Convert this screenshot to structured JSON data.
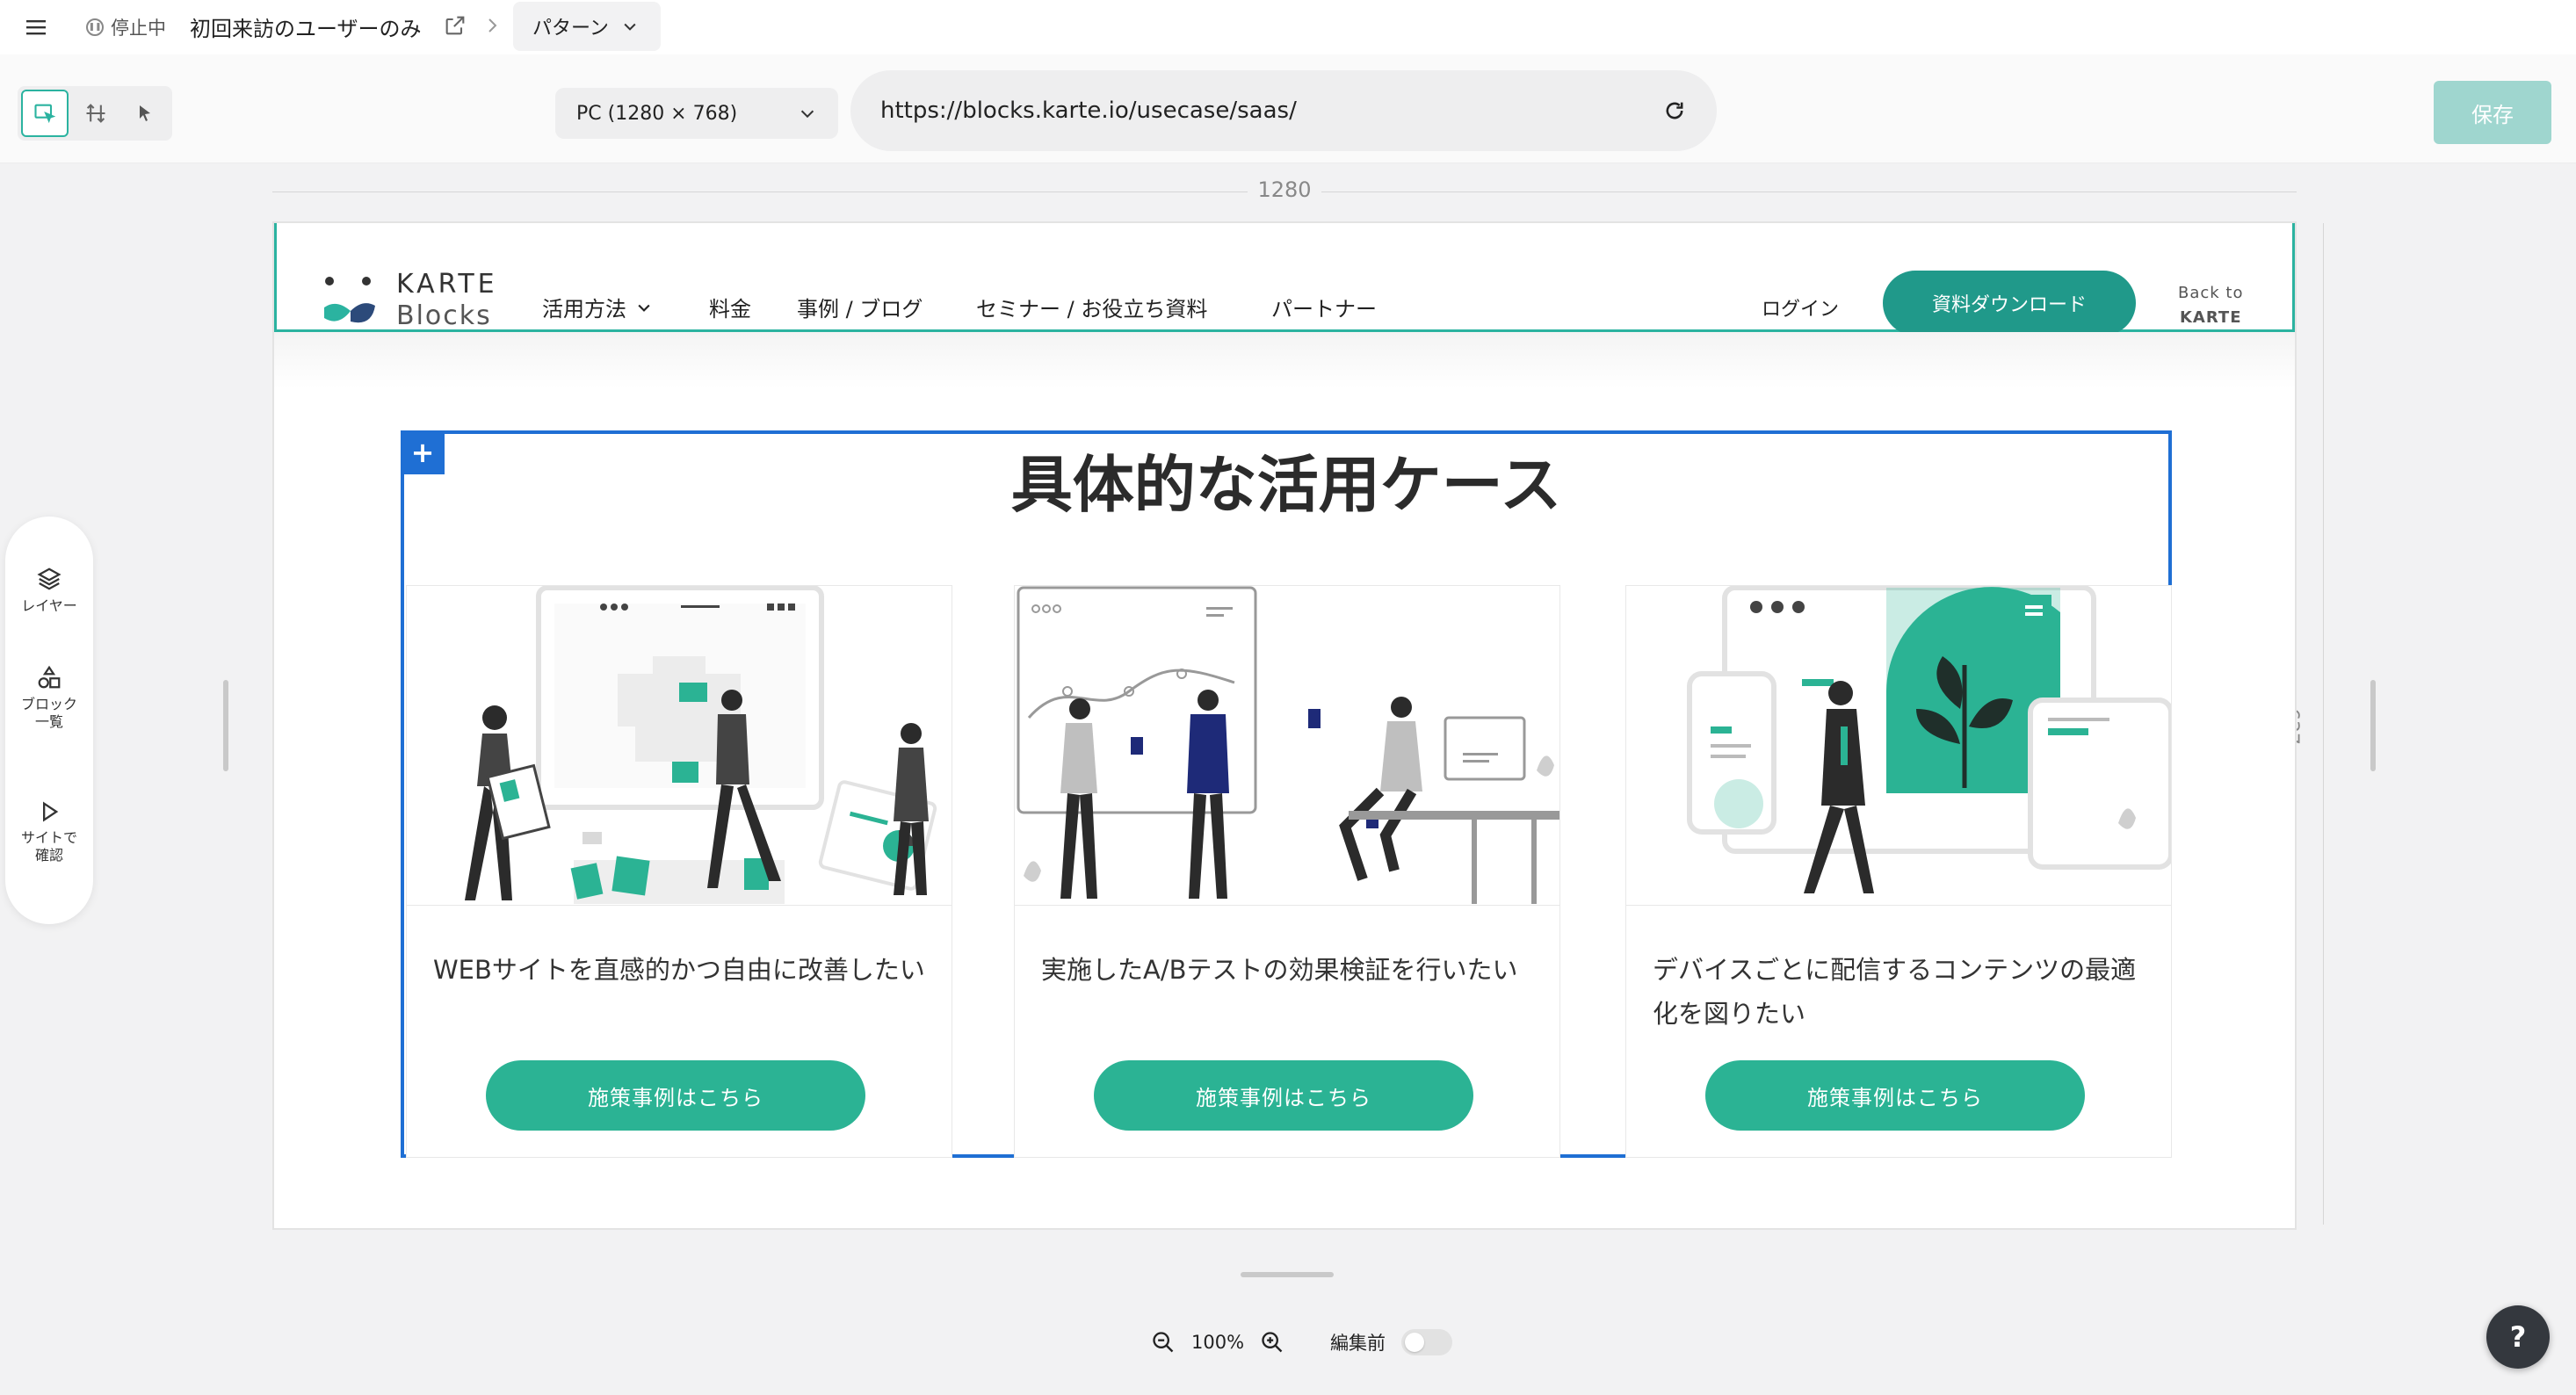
{
  "topbar": {
    "status": "停止中",
    "status_icon": "pause-icon",
    "campaign_title": "初回来訪のユーザーのみ",
    "pattern_label": "パターン"
  },
  "toolbar": {
    "device": "PC (1280 × 768)",
    "url": "https://blocks.karte.io/usecase/saas/",
    "save_label": "保存"
  },
  "sidepanel": {
    "layers": "レイヤー",
    "blocks": "ブロック\n一覧",
    "preview": "サイトで\n確認"
  },
  "canvas": {
    "width_label": "1280",
    "height_label": "637"
  },
  "site": {
    "logo_word1": "KARTE",
    "logo_word2": "Blocks",
    "nav": [
      "活用方法",
      "料金",
      "事例 / ブログ",
      "セミナー / お役立ち資料",
      "パートナー"
    ],
    "login": "ログイン",
    "cta": "資料ダウンロード",
    "back_to_1": "Back to",
    "back_to_2": "KARTE"
  },
  "block": {
    "title": "具体的な活用ケース",
    "cards": [
      {
        "text": "WEBサイトを直感的かつ自由に改善したい",
        "button": "施策事例はこちら"
      },
      {
        "text": "実施したA/Bテストの効果検証を行いたい",
        "button": "施策事例はこちら"
      },
      {
        "text": "デバイスごとに配信するコンテンツの最適化を図りたい",
        "button": "施策事例はこちら"
      }
    ]
  },
  "bottom": {
    "zoom": "100%",
    "before_label": "編集前",
    "help": "?"
  },
  "colors": {
    "accent": "#2bb3a0",
    "selection": "#1f6fd4",
    "cta": "#20998a",
    "card_button": "#2bb394",
    "save_disabled": "#9fd6cf"
  }
}
